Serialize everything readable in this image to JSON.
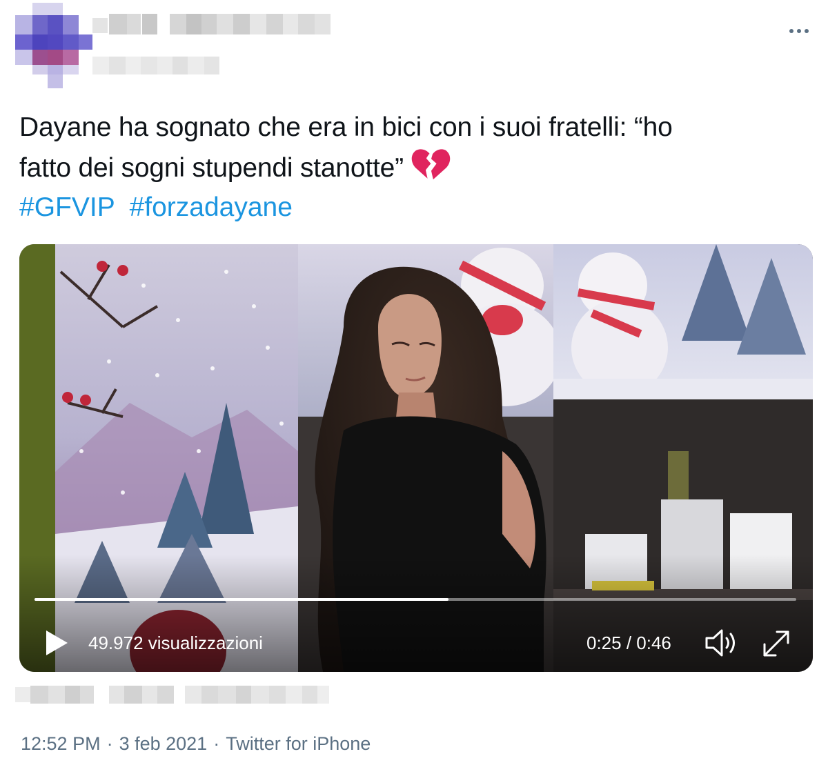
{
  "tweet": {
    "text_line_1": "Dayane ha sognato che era in bici con i suoi fratelli: “ho",
    "text_line_2": "fatto dei sogni stupendi stanotte”",
    "emoji": "broken-heart-icon",
    "hashtags": [
      "#GFVIP",
      "#forzadayane"
    ]
  },
  "video": {
    "views": "49.972 visualizzazioni",
    "timecode": "0:25 / 0:46",
    "progress": 0.5435,
    "icons": {
      "play": "play-icon",
      "volume": "volume-icon",
      "fullscreen": "fullscreen-icon"
    }
  },
  "meta": {
    "time": "12:52 PM",
    "separator": "·",
    "date": "3 feb 2021",
    "source": "Twitter for iPhone"
  },
  "colors": {
    "text": "#0f1419",
    "link": "#1b95e0",
    "muted": "#5b7083",
    "heart": "#e0245e"
  },
  "header": {
    "more_icon": "more-icon"
  }
}
